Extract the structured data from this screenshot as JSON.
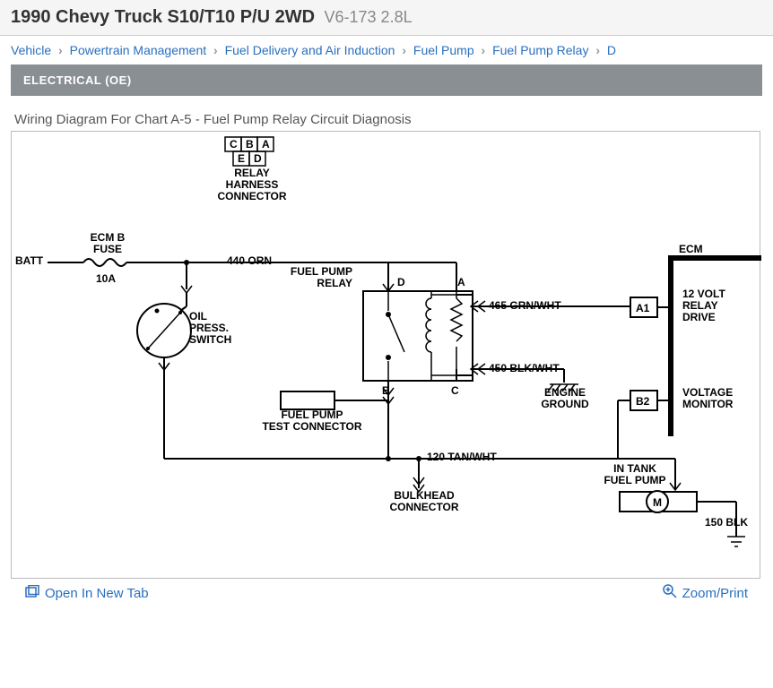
{
  "header": {
    "model": "1990 Chevy Truck S10/T10 P/U 2WD",
    "engine": "V6-173 2.8L"
  },
  "breadcrumb": {
    "items": [
      "Vehicle",
      "Powertrain Management",
      "Fuel Delivery and Air Induction",
      "Fuel Pump",
      "Fuel Pump Relay",
      "D"
    ]
  },
  "section_bar": "ELECTRICAL (OE)",
  "subtitle": "Wiring Diagram For Chart A-5 - Fuel Pump Relay Circuit Diagnosis",
  "diagram": {
    "batt": "BATT",
    "ecm_b_fuse": "ECM B\nFUSE",
    "fuse_rating": "10A",
    "wire_440": "440 ORN",
    "relay_harness_connector": "RELAY\nHARNESS\nCONNECTOR",
    "pins": {
      "a": "A",
      "b": "B",
      "c": "C",
      "d": "D",
      "e": "E"
    },
    "fuel_pump_relay": "FUEL PUMP\nRELAY",
    "oil_press_switch": "OIL\nPRESS.\nSWITCH",
    "fuel_pump_test_connector": "FUEL PUMP\nTEST CONNECTOR",
    "wire_465": "465 GRN/WHT",
    "wire_450": "450 BLK/WHT",
    "wire_120": "120 TAN/WHT",
    "bulkhead_connector": "BULKHEAD\nCONNECTOR",
    "ecm": "ECM",
    "ecm_a1": "A1",
    "ecm_b2": "B2",
    "relay_drive": "12 VOLT\nRELAY\nDRIVE",
    "voltage_monitor": "VOLTAGE\nMONITOR",
    "engine_ground": "ENGINE\nGROUND",
    "in_tank_fuel_pump": "IN TANK\nFUEL PUMP",
    "motor": "M",
    "wire_150": "150 BLK"
  },
  "footer": {
    "open_tab": "Open In New Tab",
    "zoom_print": "Zoom/Print"
  }
}
